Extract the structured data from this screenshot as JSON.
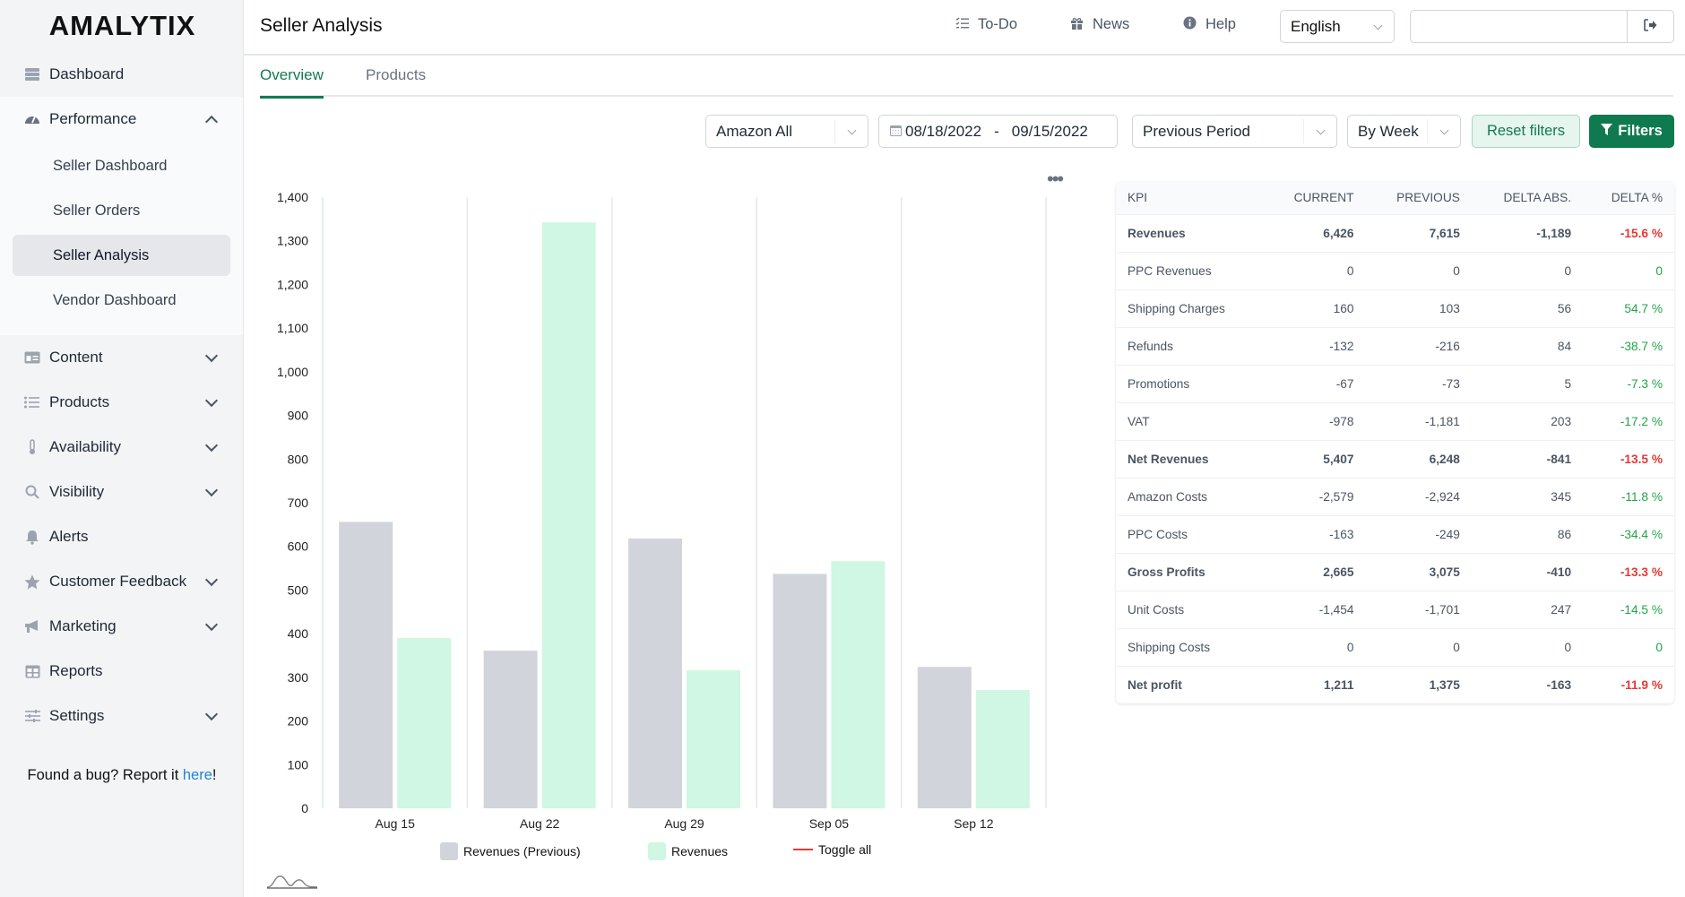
{
  "app": {
    "logo": "AMALYTIX"
  },
  "header": {
    "title": "Seller Analysis",
    "links": [
      {
        "label": "To-Do",
        "icon": "todo-list-icon"
      },
      {
        "label": "News",
        "icon": "gift-icon"
      },
      {
        "label": "Help",
        "icon": "info-icon"
      }
    ],
    "language": "English",
    "search_value": ""
  },
  "sidebar": {
    "items": [
      {
        "label": "Dashboard",
        "icon": "server-icon",
        "expandable": false
      },
      {
        "label": "Performance",
        "icon": "gauge-icon",
        "expandable": true,
        "expanded": true,
        "children": [
          "Seller Dashboard",
          "Seller Orders",
          "Seller Analysis",
          "Vendor Dashboard"
        ],
        "active_child": "Seller Analysis"
      },
      {
        "label": "Content",
        "icon": "id-card-icon",
        "expandable": true
      },
      {
        "label": "Products",
        "icon": "list-icon",
        "expandable": true
      },
      {
        "label": "Availability",
        "icon": "thermometer-icon",
        "expandable": true
      },
      {
        "label": "Visibility",
        "icon": "search-icon",
        "expandable": true
      },
      {
        "label": "Alerts",
        "icon": "bell-icon",
        "expandable": false
      },
      {
        "label": "Customer Feedback",
        "icon": "star-icon",
        "expandable": true
      },
      {
        "label": "Marketing",
        "icon": "megaphone-icon",
        "expandable": true
      },
      {
        "label": "Reports",
        "icon": "table-icon",
        "expandable": false
      },
      {
        "label": "Settings",
        "icon": "sliders-icon",
        "expandable": true
      }
    ],
    "bug_text": "Found a bug? Report it ",
    "bug_link": "here",
    "bug_suffix": "!"
  },
  "tabs": [
    {
      "label": "Overview",
      "active": true
    },
    {
      "label": "Products",
      "active": false
    }
  ],
  "filters": {
    "marketplace": "Amazon All",
    "date_from": "08/18/2022",
    "date_sep": "-",
    "date_to": "09/15/2022",
    "comparison": "Previous Period",
    "granularity": "By Week",
    "reset_label": "Reset filters",
    "filters_label": "Filters"
  },
  "chart_data": {
    "type": "bar",
    "title": "",
    "xlabel": "",
    "ylabel": "",
    "categories": [
      "Aug 15",
      "Aug 22",
      "Aug 29",
      "Sep 05",
      "Sep 12"
    ],
    "series": [
      {
        "name": "Revenues (Previous)",
        "color": "#d1d5db",
        "values": [
          656,
          361,
          618,
          537,
          324
        ]
      },
      {
        "name": "Revenues",
        "color": "#cff7e3",
        "values": [
          390,
          1342,
          316,
          566,
          271
        ]
      }
    ],
    "ylim": [
      0,
      1400
    ],
    "yticks": [
      0,
      100,
      200,
      300,
      400,
      500,
      600,
      700,
      800,
      900,
      1000,
      1100,
      1200,
      1300,
      1400
    ],
    "ytick_labels": [
      "0",
      "100",
      "200",
      "300",
      "400",
      "500",
      "600",
      "700",
      "800",
      "900",
      "1,000",
      "1,100",
      "1,200",
      "1,300",
      "1,400"
    ],
    "grid": "vertical",
    "legend": "bottom",
    "legend_extra": "Toggle all"
  },
  "kpi_table": {
    "headers": [
      "KPI",
      "CURRENT",
      "PREVIOUS",
      "DELTA ABS.",
      "DELTA %"
    ],
    "rows": [
      {
        "kpi": "Revenues",
        "current": "6,426",
        "previous": "7,615",
        "delta_abs": "-1,189",
        "delta_pct": "-15.6 %",
        "bold": true,
        "trend": "neg"
      },
      {
        "kpi": "PPC Revenues",
        "current": "0",
        "previous": "0",
        "delta_abs": "0",
        "delta_pct": "0",
        "bold": false,
        "trend": "pos"
      },
      {
        "kpi": "Shipping Charges",
        "current": "160",
        "previous": "103",
        "delta_abs": "56",
        "delta_pct": "54.7 %",
        "bold": false,
        "trend": "pos"
      },
      {
        "kpi": "Refunds",
        "current": "-132",
        "previous": "-216",
        "delta_abs": "84",
        "delta_pct": "-38.7 %",
        "bold": false,
        "trend": "pos"
      },
      {
        "kpi": "Promotions",
        "current": "-67",
        "previous": "-73",
        "delta_abs": "5",
        "delta_pct": "-7.3 %",
        "bold": false,
        "trend": "pos"
      },
      {
        "kpi": "VAT",
        "current": "-978",
        "previous": "-1,181",
        "delta_abs": "203",
        "delta_pct": "-17.2 %",
        "bold": false,
        "trend": "pos"
      },
      {
        "kpi": "Net Revenues",
        "current": "5,407",
        "previous": "6,248",
        "delta_abs": "-841",
        "delta_pct": "-13.5 %",
        "bold": true,
        "trend": "neg"
      },
      {
        "kpi": "Amazon Costs",
        "current": "-2,579",
        "previous": "-2,924",
        "delta_abs": "345",
        "delta_pct": "-11.8 %",
        "bold": false,
        "trend": "pos"
      },
      {
        "kpi": "PPC Costs",
        "current": "-163",
        "previous": "-249",
        "delta_abs": "86",
        "delta_pct": "-34.4 %",
        "bold": false,
        "trend": "pos"
      },
      {
        "kpi": "Gross Profits",
        "current": "2,665",
        "previous": "3,075",
        "delta_abs": "-410",
        "delta_pct": "-13.3 %",
        "bold": true,
        "trend": "neg"
      },
      {
        "kpi": "Unit Costs",
        "current": "-1,454",
        "previous": "-1,701",
        "delta_abs": "247",
        "delta_pct": "-14.5 %",
        "bold": false,
        "trend": "pos"
      },
      {
        "kpi": "Shipping Costs",
        "current": "0",
        "previous": "0",
        "delta_abs": "0",
        "delta_pct": "0",
        "bold": false,
        "trend": "pos"
      },
      {
        "kpi": "Net profit",
        "current": "1,211",
        "previous": "1,375",
        "delta_abs": "-163",
        "delta_pct": "-11.9 %",
        "bold": true,
        "trend": "neg"
      }
    ]
  }
}
